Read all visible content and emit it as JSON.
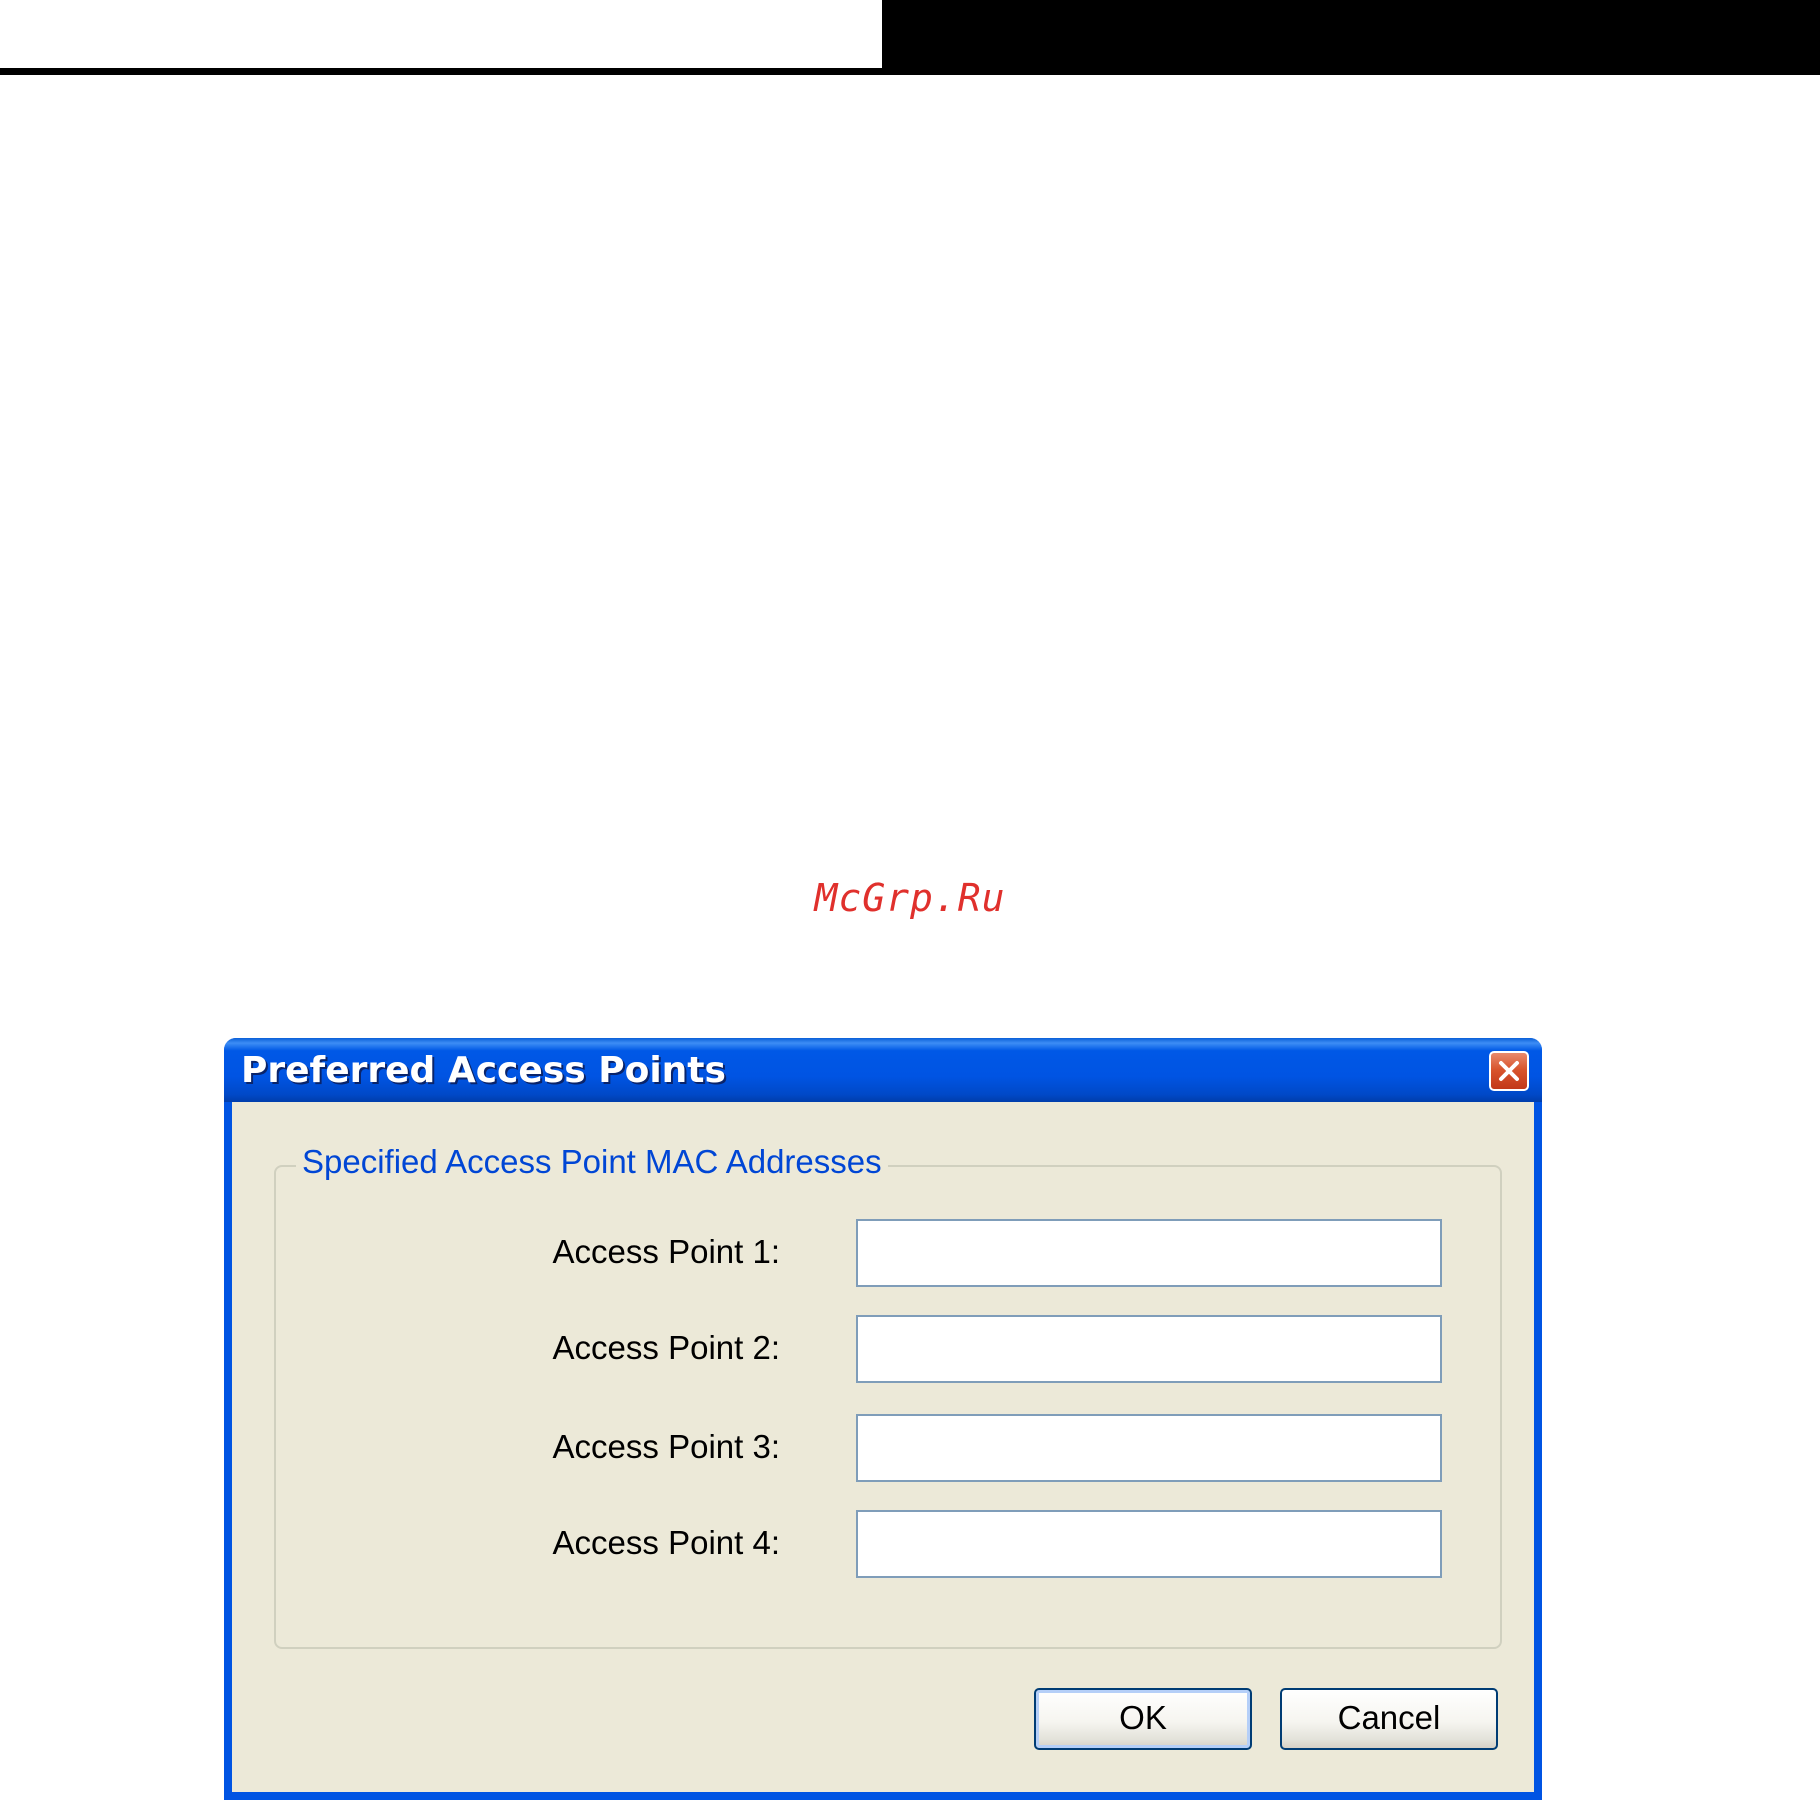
{
  "page": {
    "watermark": "McGrp.Ru",
    "watermark_color": "#e0302c"
  },
  "dialog": {
    "title": "Preferred Access Points",
    "close_icon": "close-x-icon",
    "group_title": "Specified Access Point MAC Addresses",
    "access_points": [
      {
        "label": "Access Point 1:",
        "value": ""
      },
      {
        "label": "Access Point 2:",
        "value": ""
      },
      {
        "label": "Access Point 3:",
        "value": ""
      },
      {
        "label": "Access Point 4:",
        "value": ""
      }
    ],
    "ok_label": "OK",
    "cancel_label": "Cancel"
  },
  "colors": {
    "titlebar": "#0054e3",
    "client": "#ece9d8",
    "group_label": "#0046d5",
    "close_button": "#d9552d"
  }
}
